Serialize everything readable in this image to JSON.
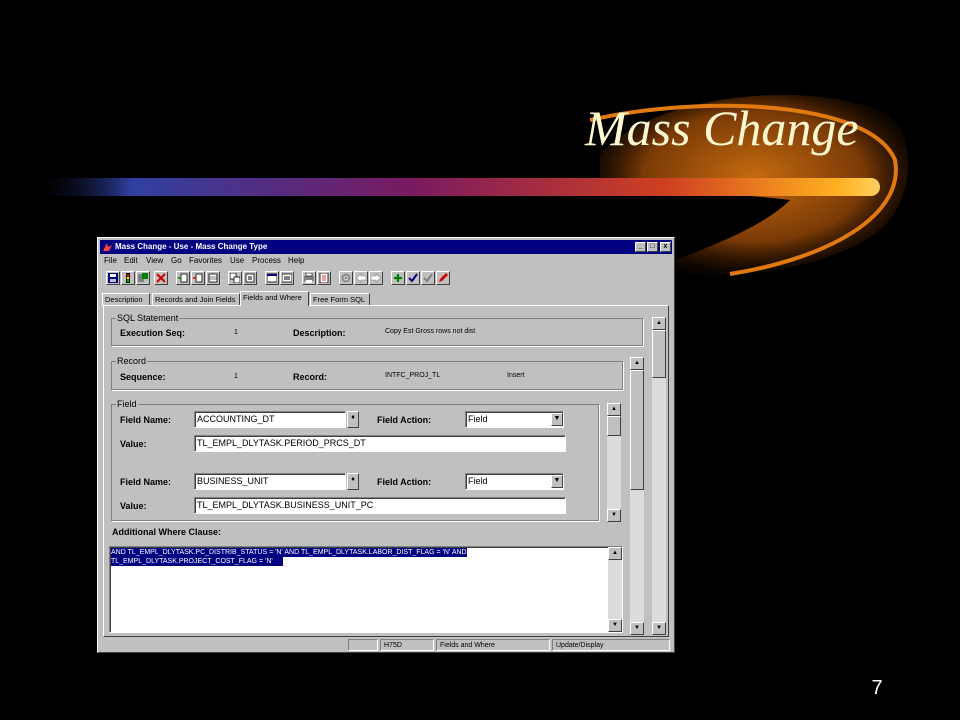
{
  "slide": {
    "title": "Mass Change",
    "page_number": "7"
  },
  "window": {
    "title": "Mass Change - Use - Mass Change Type",
    "minimize": "_",
    "maximize": "□",
    "close": "x"
  },
  "menu": [
    "File",
    "Edit",
    "View",
    "Go",
    "Favorites",
    "Use",
    "Process",
    "Help"
  ],
  "tabs": [
    "Description",
    "Records and Join Fields",
    "Fields and Where",
    "Free Form SQL"
  ],
  "active_tab": "Fields and Where",
  "sql": {
    "group": "SQL Statement",
    "exec_label": "Execution Seq:",
    "exec_value": "1",
    "desc_label": "Description:",
    "desc_value": "Copy Est Gross rows not dist"
  },
  "record": {
    "group": "Record",
    "seq_label": "Sequence:",
    "seq_value": "1",
    "rec_label": "Record:",
    "rec_value": "INTFC_PROJ_TL",
    "type_value": "Insert"
  },
  "field": {
    "group": "Field",
    "rows": [
      {
        "name_label": "Field Name:",
        "name": "ACCOUNTING_DT",
        "action_label": "Field Action:",
        "action": "Field",
        "value_label": "Value:",
        "value": "TL_EMPL_DLYTASK.PERIOD_PRCS_DT"
      },
      {
        "name_label": "Field Name:",
        "name": "BUSINESS_UNIT",
        "action_label": "Field Action:",
        "action": "Field",
        "value_label": "Value:",
        "value": "TL_EMPL_DLYTASK.BUSINESS_UNIT_PC"
      }
    ]
  },
  "where": {
    "label": "Additional Where Clause:",
    "line1": "AND TL_EMPL_DLYTASK.PC_DISTRIB_STATUS = 'N' AND TL_EMPL_DLYTASK.LABOR_DIST_FLAG = 'N' AND",
    "line2": "TL_EMPL_DLYTASK.PROJECT_COST_FLAG = 'N'"
  },
  "status": {
    "code": "H75D",
    "page": "Fields and Where",
    "mode": "Update/Display"
  },
  "colors": {
    "title_bar": "#000080",
    "window": "#c0c0c0",
    "slide_title": "#fff7d0",
    "swoosh": "#e07a10"
  }
}
